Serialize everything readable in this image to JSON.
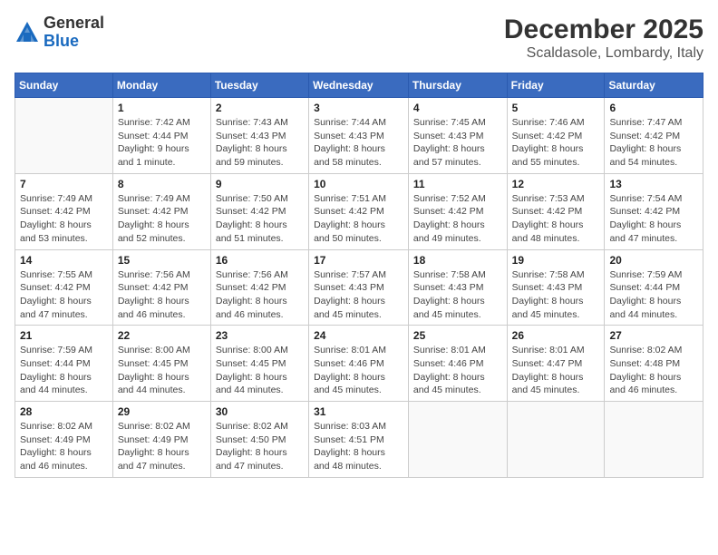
{
  "header": {
    "logo_line1": "General",
    "logo_line2": "Blue",
    "month": "December 2025",
    "location": "Scaldasole, Lombardy, Italy"
  },
  "weekdays": [
    "Sunday",
    "Monday",
    "Tuesday",
    "Wednesday",
    "Thursday",
    "Friday",
    "Saturday"
  ],
  "weeks": [
    [
      {
        "day": "",
        "info": ""
      },
      {
        "day": "1",
        "info": "Sunrise: 7:42 AM\nSunset: 4:44 PM\nDaylight: 9 hours\nand 1 minute."
      },
      {
        "day": "2",
        "info": "Sunrise: 7:43 AM\nSunset: 4:43 PM\nDaylight: 8 hours\nand 59 minutes."
      },
      {
        "day": "3",
        "info": "Sunrise: 7:44 AM\nSunset: 4:43 PM\nDaylight: 8 hours\nand 58 minutes."
      },
      {
        "day": "4",
        "info": "Sunrise: 7:45 AM\nSunset: 4:43 PM\nDaylight: 8 hours\nand 57 minutes."
      },
      {
        "day": "5",
        "info": "Sunrise: 7:46 AM\nSunset: 4:42 PM\nDaylight: 8 hours\nand 55 minutes."
      },
      {
        "day": "6",
        "info": "Sunrise: 7:47 AM\nSunset: 4:42 PM\nDaylight: 8 hours\nand 54 minutes."
      }
    ],
    [
      {
        "day": "7",
        "info": "Sunrise: 7:49 AM\nSunset: 4:42 PM\nDaylight: 8 hours\nand 53 minutes."
      },
      {
        "day": "8",
        "info": "Sunrise: 7:49 AM\nSunset: 4:42 PM\nDaylight: 8 hours\nand 52 minutes."
      },
      {
        "day": "9",
        "info": "Sunrise: 7:50 AM\nSunset: 4:42 PM\nDaylight: 8 hours\nand 51 minutes."
      },
      {
        "day": "10",
        "info": "Sunrise: 7:51 AM\nSunset: 4:42 PM\nDaylight: 8 hours\nand 50 minutes."
      },
      {
        "day": "11",
        "info": "Sunrise: 7:52 AM\nSunset: 4:42 PM\nDaylight: 8 hours\nand 49 minutes."
      },
      {
        "day": "12",
        "info": "Sunrise: 7:53 AM\nSunset: 4:42 PM\nDaylight: 8 hours\nand 48 minutes."
      },
      {
        "day": "13",
        "info": "Sunrise: 7:54 AM\nSunset: 4:42 PM\nDaylight: 8 hours\nand 47 minutes."
      }
    ],
    [
      {
        "day": "14",
        "info": "Sunrise: 7:55 AM\nSunset: 4:42 PM\nDaylight: 8 hours\nand 47 minutes."
      },
      {
        "day": "15",
        "info": "Sunrise: 7:56 AM\nSunset: 4:42 PM\nDaylight: 8 hours\nand 46 minutes."
      },
      {
        "day": "16",
        "info": "Sunrise: 7:56 AM\nSunset: 4:42 PM\nDaylight: 8 hours\nand 46 minutes."
      },
      {
        "day": "17",
        "info": "Sunrise: 7:57 AM\nSunset: 4:43 PM\nDaylight: 8 hours\nand 45 minutes."
      },
      {
        "day": "18",
        "info": "Sunrise: 7:58 AM\nSunset: 4:43 PM\nDaylight: 8 hours\nand 45 minutes."
      },
      {
        "day": "19",
        "info": "Sunrise: 7:58 AM\nSunset: 4:43 PM\nDaylight: 8 hours\nand 45 minutes."
      },
      {
        "day": "20",
        "info": "Sunrise: 7:59 AM\nSunset: 4:44 PM\nDaylight: 8 hours\nand 44 minutes."
      }
    ],
    [
      {
        "day": "21",
        "info": "Sunrise: 7:59 AM\nSunset: 4:44 PM\nDaylight: 8 hours\nand 44 minutes."
      },
      {
        "day": "22",
        "info": "Sunrise: 8:00 AM\nSunset: 4:45 PM\nDaylight: 8 hours\nand 44 minutes."
      },
      {
        "day": "23",
        "info": "Sunrise: 8:00 AM\nSunset: 4:45 PM\nDaylight: 8 hours\nand 44 minutes."
      },
      {
        "day": "24",
        "info": "Sunrise: 8:01 AM\nSunset: 4:46 PM\nDaylight: 8 hours\nand 45 minutes."
      },
      {
        "day": "25",
        "info": "Sunrise: 8:01 AM\nSunset: 4:46 PM\nDaylight: 8 hours\nand 45 minutes."
      },
      {
        "day": "26",
        "info": "Sunrise: 8:01 AM\nSunset: 4:47 PM\nDaylight: 8 hours\nand 45 minutes."
      },
      {
        "day": "27",
        "info": "Sunrise: 8:02 AM\nSunset: 4:48 PM\nDaylight: 8 hours\nand 46 minutes."
      }
    ],
    [
      {
        "day": "28",
        "info": "Sunrise: 8:02 AM\nSunset: 4:49 PM\nDaylight: 8 hours\nand 46 minutes."
      },
      {
        "day": "29",
        "info": "Sunrise: 8:02 AM\nSunset: 4:49 PM\nDaylight: 8 hours\nand 47 minutes."
      },
      {
        "day": "30",
        "info": "Sunrise: 8:02 AM\nSunset: 4:50 PM\nDaylight: 8 hours\nand 47 minutes."
      },
      {
        "day": "31",
        "info": "Sunrise: 8:03 AM\nSunset: 4:51 PM\nDaylight: 8 hours\nand 48 minutes."
      },
      {
        "day": "",
        "info": ""
      },
      {
        "day": "",
        "info": ""
      },
      {
        "day": "",
        "info": ""
      }
    ]
  ]
}
